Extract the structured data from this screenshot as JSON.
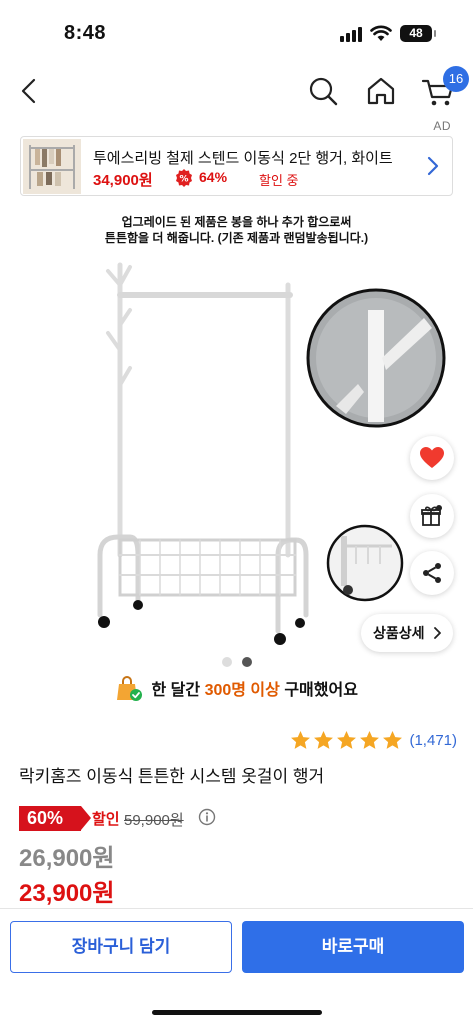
{
  "status_bar": {
    "time": "8:48",
    "battery": "48"
  },
  "cart": {
    "badge_count": "16"
  },
  "ad": {
    "label": "AD",
    "title": "투에스리빙 철제 스텐드 이동식 2단 행거, 화이트",
    "price": "34,900원",
    "discount_rate": "64%",
    "sale_text": "할인 중"
  },
  "product_note": {
    "line1": "업그레이드 된 제품은 봉을 하나 추가 합으로써",
    "line2": "튼튼함을 더 해줍니다. (기존 제품과 랜덤발송됩니다.)"
  },
  "detail_button": {
    "label": "상품상세"
  },
  "carousel": {
    "total": 2,
    "active": 2
  },
  "buyers": {
    "prefix": "한 달간",
    "count": "300명 이상",
    "suffix": "구매했어요"
  },
  "rating": {
    "stars": 5,
    "count": "(1,471)"
  },
  "product": {
    "title": "락키홈즈 이동식 튼튼한 시스템 옷걸이 행거",
    "discount_rate": "60%",
    "sale_word": "할인",
    "original_price": "59,900원",
    "price_before_coupon": "26,900원",
    "final_price": "23,900원"
  },
  "actions": {
    "cart_label": "장바구니 담기",
    "buy_label": "바로구매"
  },
  "colors": {
    "accent_blue": "#2f6fe8",
    "sale_red": "#d6121c",
    "highlight_orange": "#e05a00"
  }
}
